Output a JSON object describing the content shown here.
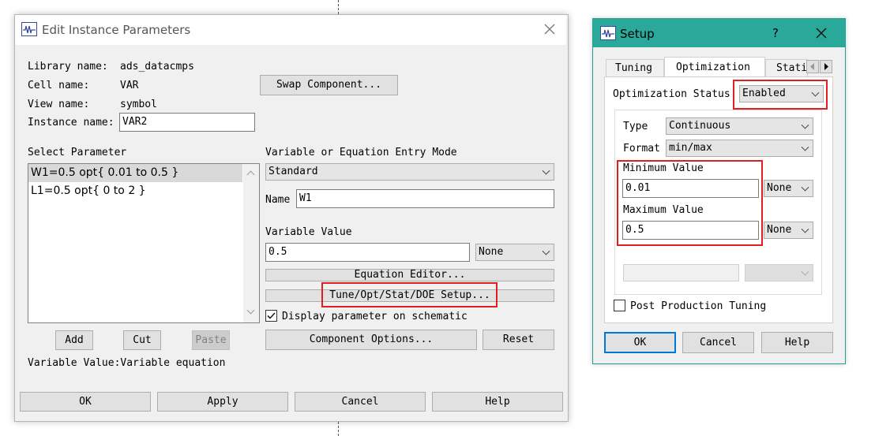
{
  "colors": {
    "highlight": "#e02020",
    "dialog_bg": "#f0f0f0",
    "accent_border": "#0078d7",
    "setup_frame": "#23a28f"
  },
  "edit_dialog": {
    "title": "Edit Instance Parameters",
    "icon": "schematic-app-icon",
    "library_label": "Library name:",
    "library_value": "ads_datacmps",
    "cell_label": "Cell name:",
    "cell_value": "VAR",
    "view_label": "View name:",
    "view_value": "symbol",
    "instance_label": "Instance name:",
    "instance_value": "VAR2",
    "swap_button": "Swap Component...",
    "select_parameter_label": "Select Parameter",
    "parameters": [
      "W1=0.5 opt{ 0.01 to 0.5 }",
      "L1=0.5 opt{ 0 to 2 }"
    ],
    "add_button": "Add",
    "cut_button": "Cut",
    "paste_button": "Paste",
    "variable_value_status": "Variable Value:Variable equation",
    "entry_mode_label": "Variable or Equation Entry Mode",
    "entry_mode_value": "Standard",
    "name_label": "Name",
    "name_value": "W1",
    "variable_value_label": "Variable Value",
    "variable_value": "0.5",
    "unit_value": "None",
    "equation_editor_button": "Equation Editor...",
    "tune_opt_button": "Tune/Opt/Stat/DOE Setup...",
    "display_param_label": "Display parameter on schematic",
    "display_param_checked": true,
    "component_options_button": "Component Options...",
    "reset_button": "Reset",
    "ok_button": "OK",
    "apply_button": "Apply",
    "cancel_button": "Cancel",
    "help_button": "Help"
  },
  "setup_dialog": {
    "title": "Setup",
    "help_glyph": "?",
    "tabs": [
      "Tuning",
      "Optimization",
      "Stati"
    ],
    "active_tab": "Optimization",
    "opt_status_label": "Optimization Status",
    "opt_status_value": "Enabled",
    "type_label": "Type",
    "type_value": "Continuous",
    "format_label": "Format",
    "format_value": "min/max",
    "min_label": "Minimum Value",
    "min_value": "0.01",
    "min_unit": "None",
    "max_label": "Maximum Value",
    "max_value": "0.5",
    "max_unit": "None",
    "post_production_label": "Post Production Tuning",
    "ok_button": "OK",
    "cancel_button": "Cancel",
    "help_button": "Help"
  }
}
